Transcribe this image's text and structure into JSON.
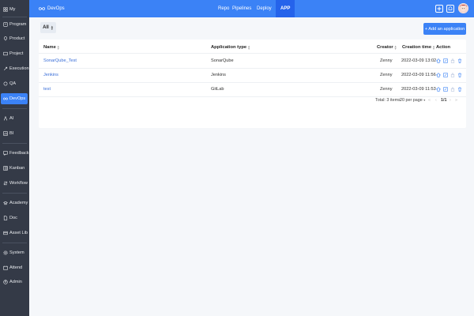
{
  "sidebar": {
    "items": [
      {
        "label": "My",
        "icon": "grid-icon"
      },
      {
        "label": "Program",
        "icon": "program-icon"
      },
      {
        "label": "Product",
        "icon": "product-icon"
      },
      {
        "label": "Project",
        "icon": "project-icon"
      },
      {
        "label": "Execution",
        "icon": "execution-icon"
      },
      {
        "label": "QA",
        "icon": "qa-icon"
      },
      {
        "label": "DevOps",
        "icon": "devops-icon"
      },
      {
        "label": "AI",
        "icon": "ai-icon"
      },
      {
        "label": "BI",
        "icon": "bi-icon"
      },
      {
        "label": "Feedback",
        "icon": "feedback-icon"
      },
      {
        "label": "Kanban",
        "icon": "kanban-icon"
      },
      {
        "label": "Workflow",
        "icon": "workflow-icon"
      },
      {
        "label": "Academy",
        "icon": "academy-icon"
      },
      {
        "label": "Doc",
        "icon": "doc-icon"
      },
      {
        "label": "Asset Lib",
        "icon": "asset-lib-icon"
      },
      {
        "label": "System",
        "icon": "system-icon"
      },
      {
        "label": "Attend",
        "icon": "attend-icon"
      },
      {
        "label": "Admin",
        "icon": "admin-icon"
      }
    ],
    "active": "DevOps",
    "accent": "#3b82f6",
    "background": "#343a47"
  },
  "header": {
    "brand": "DevOps",
    "tabs": [
      {
        "label": "Repo"
      },
      {
        "label": "Pipelines"
      },
      {
        "label": "Deploy"
      },
      {
        "label": "APP"
      }
    ],
    "active_tab": "APP",
    "color": "#3b82f6"
  },
  "toolbar": {
    "filter_label": "All",
    "add_label": "+ Add an application"
  },
  "table": {
    "columns": [
      "Name",
      "Application type",
      "Creator",
      "Creation time",
      "Action"
    ],
    "rows": [
      {
        "name": "SonarQube_Test",
        "type": "SonarQube",
        "creator": "Zenny",
        "time": "2022-03-09 13:02"
      },
      {
        "name": "Jenkins",
        "type": "Jenkins",
        "creator": "Zenny",
        "time": "2022-03-09 11:56"
      },
      {
        "name": "test",
        "type": "GitLab",
        "creator": "Zenny",
        "time": "2022-03-09 11:53"
      }
    ]
  },
  "pager": {
    "total": "Total: 3 items",
    "per_page": "20 per page",
    "page": "1/1"
  }
}
